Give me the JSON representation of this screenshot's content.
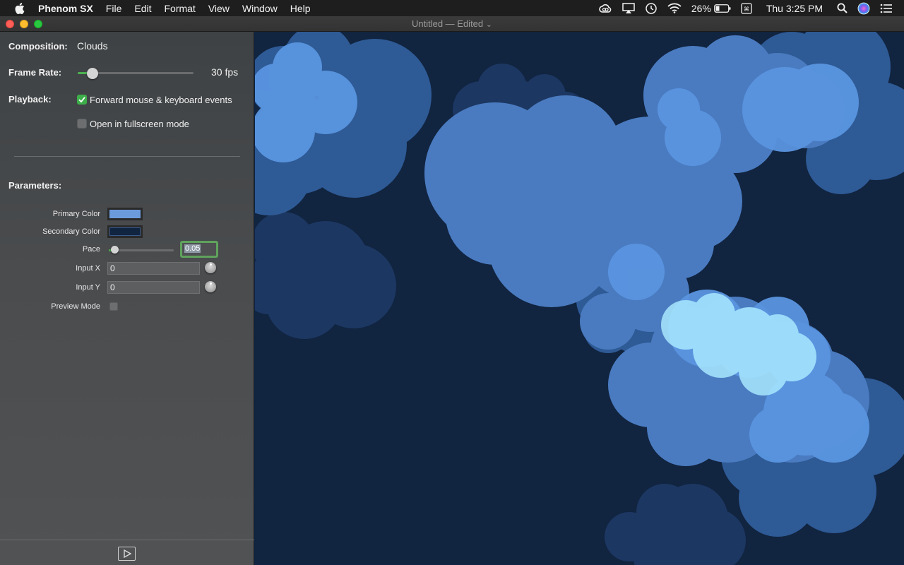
{
  "menubar": {
    "apple_icon": "apple-logo-icon",
    "app_name": "Phenom SX",
    "items": [
      "File",
      "Edit",
      "Format",
      "View",
      "Window",
      "Help"
    ],
    "battery": "26%",
    "clock": "Thu 3:25 PM"
  },
  "window": {
    "title": "Untitled — Edited",
    "title_chevron": "⌄"
  },
  "sidebar": {
    "composition_label": "Composition:",
    "composition_value": "Clouds",
    "frame_rate_label": "Frame Rate:",
    "frame_rate_value": "30 fps",
    "playback_label": "Playback:",
    "forward_events_label": "Forward mouse & keyboard events",
    "forward_events_checked": true,
    "fullscreen_label": "Open in fullscreen mode",
    "fullscreen_checked": false,
    "parameters_label": "Parameters:",
    "params": {
      "primary_color_label": "Primary Color",
      "primary_color": "#6c9bdc",
      "secondary_color_label": "Secondary Color",
      "secondary_color": "#112440",
      "pace_label": "Pace",
      "pace_value": "0.05",
      "input_x_label": "Input X",
      "input_x_value": "0",
      "input_y_label": "Input Y",
      "input_y_value": "0",
      "preview_mode_label": "Preview Mode",
      "preview_mode_checked": false
    },
    "play_icon": "play-icon"
  },
  "colors": {
    "accent_green": "#3cae4a",
    "canvas_bg": "#112440"
  }
}
